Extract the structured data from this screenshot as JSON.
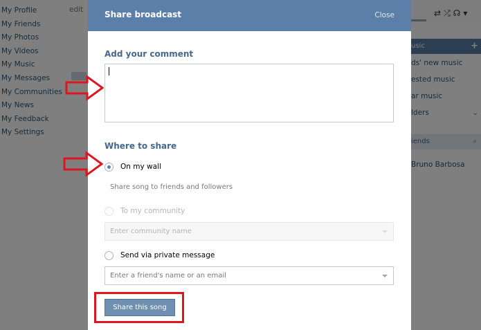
{
  "background": {
    "side_menu": [
      "My Profile",
      "My Friends",
      "My Photos",
      "My Videos",
      "My Music",
      "My Messages",
      "My Communities",
      "My News",
      "My Feedback",
      "My Settings"
    ],
    "edit_label": "edit",
    "music_header": "usic",
    "music_items": [
      "ds' new music",
      "ested music",
      "ar music",
      "lders"
    ],
    "friends_header": "iends",
    "friend_name": "Bruno Barbosa"
  },
  "modal": {
    "title": "Share broadcast",
    "close_label": "Close",
    "comment_section_title": "Add your comment",
    "comment_value": "",
    "share_section_title": "Where to share",
    "options": {
      "wall_label": "On my wall",
      "wall_hint": "Share song to friends and followers",
      "community_label": "To my community",
      "community_placeholder": "Enter community name",
      "message_label": "Send via private message",
      "message_placeholder": "Enter a friend's name or an email"
    },
    "selected_option": "On my wall",
    "share_button_label": "Share this song"
  },
  "colors": {
    "header_blue": "#5b7fa8",
    "section_title": "#45688e",
    "annotation_red": "#e0141e"
  }
}
